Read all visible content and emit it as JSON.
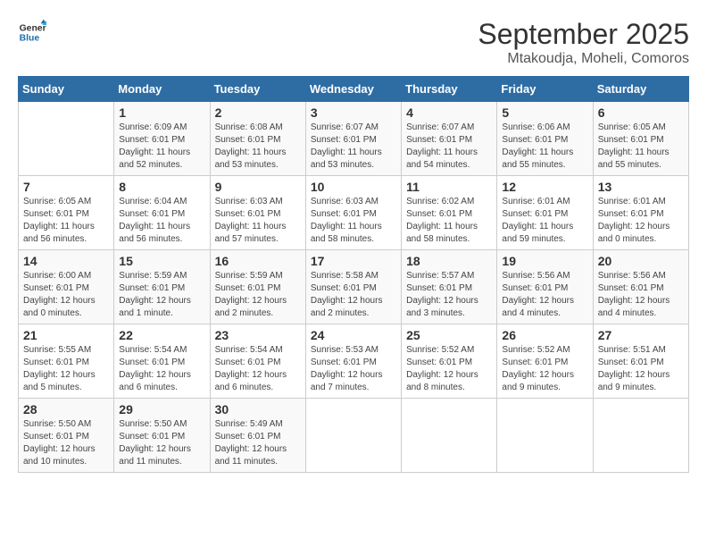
{
  "logo": {
    "line1": "General",
    "line2": "Blue"
  },
  "title": "September 2025",
  "location": "Mtakoudja, Moheli, Comoros",
  "weekdays": [
    "Sunday",
    "Monday",
    "Tuesday",
    "Wednesday",
    "Thursday",
    "Friday",
    "Saturday"
  ],
  "weeks": [
    [
      {
        "day": "",
        "sunrise": "",
        "sunset": "",
        "daylight": ""
      },
      {
        "day": "1",
        "sunrise": "Sunrise: 6:09 AM",
        "sunset": "Sunset: 6:01 PM",
        "daylight": "Daylight: 11 hours and 52 minutes."
      },
      {
        "day": "2",
        "sunrise": "Sunrise: 6:08 AM",
        "sunset": "Sunset: 6:01 PM",
        "daylight": "Daylight: 11 hours and 53 minutes."
      },
      {
        "day": "3",
        "sunrise": "Sunrise: 6:07 AM",
        "sunset": "Sunset: 6:01 PM",
        "daylight": "Daylight: 11 hours and 53 minutes."
      },
      {
        "day": "4",
        "sunrise": "Sunrise: 6:07 AM",
        "sunset": "Sunset: 6:01 PM",
        "daylight": "Daylight: 11 hours and 54 minutes."
      },
      {
        "day": "5",
        "sunrise": "Sunrise: 6:06 AM",
        "sunset": "Sunset: 6:01 PM",
        "daylight": "Daylight: 11 hours and 55 minutes."
      },
      {
        "day": "6",
        "sunrise": "Sunrise: 6:05 AM",
        "sunset": "Sunset: 6:01 PM",
        "daylight": "Daylight: 11 hours and 55 minutes."
      }
    ],
    [
      {
        "day": "7",
        "sunrise": "Sunrise: 6:05 AM",
        "sunset": "Sunset: 6:01 PM",
        "daylight": "Daylight: 11 hours and 56 minutes."
      },
      {
        "day": "8",
        "sunrise": "Sunrise: 6:04 AM",
        "sunset": "Sunset: 6:01 PM",
        "daylight": "Daylight: 11 hours and 56 minutes."
      },
      {
        "day": "9",
        "sunrise": "Sunrise: 6:03 AM",
        "sunset": "Sunset: 6:01 PM",
        "daylight": "Daylight: 11 hours and 57 minutes."
      },
      {
        "day": "10",
        "sunrise": "Sunrise: 6:03 AM",
        "sunset": "Sunset: 6:01 PM",
        "daylight": "Daylight: 11 hours and 58 minutes."
      },
      {
        "day": "11",
        "sunrise": "Sunrise: 6:02 AM",
        "sunset": "Sunset: 6:01 PM",
        "daylight": "Daylight: 11 hours and 58 minutes."
      },
      {
        "day": "12",
        "sunrise": "Sunrise: 6:01 AM",
        "sunset": "Sunset: 6:01 PM",
        "daylight": "Daylight: 11 hours and 59 minutes."
      },
      {
        "day": "13",
        "sunrise": "Sunrise: 6:01 AM",
        "sunset": "Sunset: 6:01 PM",
        "daylight": "Daylight: 12 hours and 0 minutes."
      }
    ],
    [
      {
        "day": "14",
        "sunrise": "Sunrise: 6:00 AM",
        "sunset": "Sunset: 6:01 PM",
        "daylight": "Daylight: 12 hours and 0 minutes."
      },
      {
        "day": "15",
        "sunrise": "Sunrise: 5:59 AM",
        "sunset": "Sunset: 6:01 PM",
        "daylight": "Daylight: 12 hours and 1 minute."
      },
      {
        "day": "16",
        "sunrise": "Sunrise: 5:59 AM",
        "sunset": "Sunset: 6:01 PM",
        "daylight": "Daylight: 12 hours and 2 minutes."
      },
      {
        "day": "17",
        "sunrise": "Sunrise: 5:58 AM",
        "sunset": "Sunset: 6:01 PM",
        "daylight": "Daylight: 12 hours and 2 minutes."
      },
      {
        "day": "18",
        "sunrise": "Sunrise: 5:57 AM",
        "sunset": "Sunset: 6:01 PM",
        "daylight": "Daylight: 12 hours and 3 minutes."
      },
      {
        "day": "19",
        "sunrise": "Sunrise: 5:56 AM",
        "sunset": "Sunset: 6:01 PM",
        "daylight": "Daylight: 12 hours and 4 minutes."
      },
      {
        "day": "20",
        "sunrise": "Sunrise: 5:56 AM",
        "sunset": "Sunset: 6:01 PM",
        "daylight": "Daylight: 12 hours and 4 minutes."
      }
    ],
    [
      {
        "day": "21",
        "sunrise": "Sunrise: 5:55 AM",
        "sunset": "Sunset: 6:01 PM",
        "daylight": "Daylight: 12 hours and 5 minutes."
      },
      {
        "day": "22",
        "sunrise": "Sunrise: 5:54 AM",
        "sunset": "Sunset: 6:01 PM",
        "daylight": "Daylight: 12 hours and 6 minutes."
      },
      {
        "day": "23",
        "sunrise": "Sunrise: 5:54 AM",
        "sunset": "Sunset: 6:01 PM",
        "daylight": "Daylight: 12 hours and 6 minutes."
      },
      {
        "day": "24",
        "sunrise": "Sunrise: 5:53 AM",
        "sunset": "Sunset: 6:01 PM",
        "daylight": "Daylight: 12 hours and 7 minutes."
      },
      {
        "day": "25",
        "sunrise": "Sunrise: 5:52 AM",
        "sunset": "Sunset: 6:01 PM",
        "daylight": "Daylight: 12 hours and 8 minutes."
      },
      {
        "day": "26",
        "sunrise": "Sunrise: 5:52 AM",
        "sunset": "Sunset: 6:01 PM",
        "daylight": "Daylight: 12 hours and 9 minutes."
      },
      {
        "day": "27",
        "sunrise": "Sunrise: 5:51 AM",
        "sunset": "Sunset: 6:01 PM",
        "daylight": "Daylight: 12 hours and 9 minutes."
      }
    ],
    [
      {
        "day": "28",
        "sunrise": "Sunrise: 5:50 AM",
        "sunset": "Sunset: 6:01 PM",
        "daylight": "Daylight: 12 hours and 10 minutes."
      },
      {
        "day": "29",
        "sunrise": "Sunrise: 5:50 AM",
        "sunset": "Sunset: 6:01 PM",
        "daylight": "Daylight: 12 hours and 11 minutes."
      },
      {
        "day": "30",
        "sunrise": "Sunrise: 5:49 AM",
        "sunset": "Sunset: 6:01 PM",
        "daylight": "Daylight: 12 hours and 11 minutes."
      },
      {
        "day": "",
        "sunrise": "",
        "sunset": "",
        "daylight": ""
      },
      {
        "day": "",
        "sunrise": "",
        "sunset": "",
        "daylight": ""
      },
      {
        "day": "",
        "sunrise": "",
        "sunset": "",
        "daylight": ""
      },
      {
        "day": "",
        "sunrise": "",
        "sunset": "",
        "daylight": ""
      }
    ]
  ]
}
